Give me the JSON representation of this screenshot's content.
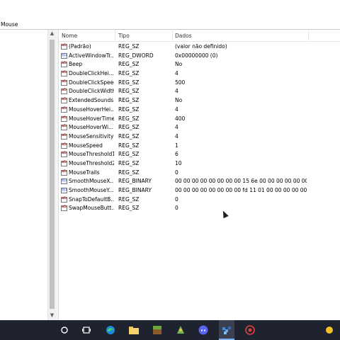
{
  "address": {
    "path": "Mouse"
  },
  "columns": {
    "name": "Nome",
    "type": "Tipo",
    "data": "Dados"
  },
  "entries": [
    {
      "name": "(Padrão)",
      "type": "REG_SZ",
      "data": "(valor não definido)",
      "icon": "string-value-icon"
    },
    {
      "name": "ActiveWindowTr...",
      "type": "REG_DWORD",
      "data": "0x00000000 (0)",
      "icon": "binary-value-icon"
    },
    {
      "name": "Beep",
      "type": "REG_SZ",
      "data": "No",
      "icon": "string-value-icon"
    },
    {
      "name": "DoubleClickHei...",
      "type": "REG_SZ",
      "data": "4",
      "icon": "string-value-icon"
    },
    {
      "name": "DoubleClickSpeed",
      "type": "REG_SZ",
      "data": "500",
      "icon": "string-value-icon"
    },
    {
      "name": "DoubleClickWidth",
      "type": "REG_SZ",
      "data": "4",
      "icon": "string-value-icon"
    },
    {
      "name": "ExtendedSounds",
      "type": "REG_SZ",
      "data": "No",
      "icon": "string-value-icon"
    },
    {
      "name": "MouseHoverHei...",
      "type": "REG_SZ",
      "data": "4",
      "icon": "string-value-icon"
    },
    {
      "name": "MouseHoverTime",
      "type": "REG_SZ",
      "data": "400",
      "icon": "string-value-icon"
    },
    {
      "name": "MouseHoverWi...",
      "type": "REG_SZ",
      "data": "4",
      "icon": "string-value-icon"
    },
    {
      "name": "MouseSensitivity",
      "type": "REG_SZ",
      "data": "4",
      "icon": "string-value-icon"
    },
    {
      "name": "MouseSpeed",
      "type": "REG_SZ",
      "data": "1",
      "icon": "string-value-icon"
    },
    {
      "name": "MouseThreshold1",
      "type": "REG_SZ",
      "data": "6",
      "icon": "string-value-icon"
    },
    {
      "name": "MouseThreshold2",
      "type": "REG_SZ",
      "data": "10",
      "icon": "string-value-icon"
    },
    {
      "name": "MouseTrails",
      "type": "REG_SZ",
      "data": "0",
      "icon": "string-value-icon"
    },
    {
      "name": "SmoothMouseX...",
      "type": "REG_BINARY",
      "data": "00 00 00 00 00 00 00 00 15 6e 00 00 00 00 00 00 00 40...",
      "icon": "binary-value-icon"
    },
    {
      "name": "SmoothMouseY...",
      "type": "REG_BINARY",
      "data": "00 00 00 00 00 00 00 00 fd 11 01 00 00 00 00 00 00 24...",
      "icon": "binary-value-icon"
    },
    {
      "name": "SnapToDefaultB...",
      "type": "REG_SZ",
      "data": "0",
      "icon": "string-value-icon"
    },
    {
      "name": "SwapMouseButt...",
      "type": "REG_SZ",
      "data": "0",
      "icon": "string-value-icon"
    }
  ],
  "taskbar": {
    "background": "#1f2330",
    "icons": [
      "search-icon",
      "task-view-icon",
      "edge-icon",
      "file-explorer-icon",
      "minecraft-icon",
      "game-icon",
      "discord-icon",
      "registry-editor-icon",
      "recorder-icon",
      "weather-icon"
    ]
  }
}
